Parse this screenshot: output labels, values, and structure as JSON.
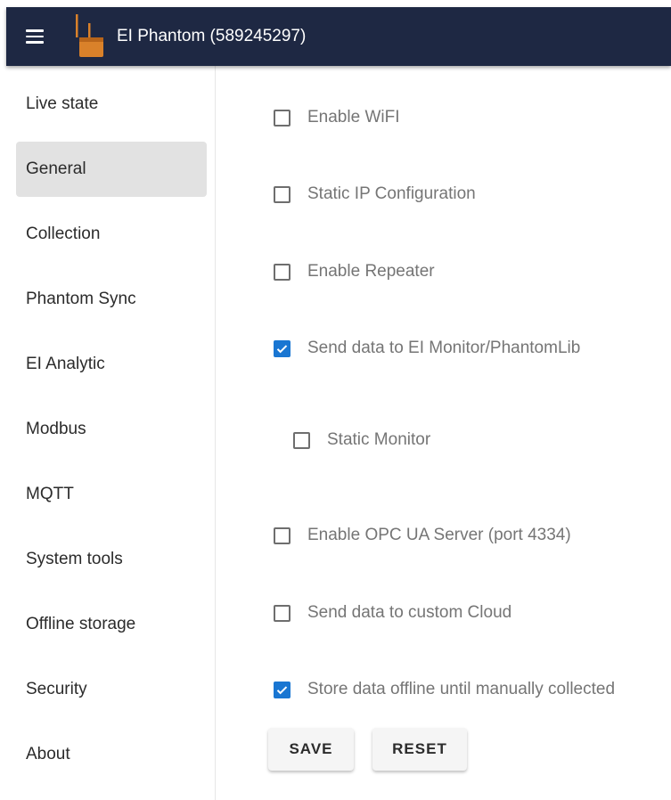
{
  "appbar": {
    "title": "EI Phantom (589245297)",
    "menu_icon": "hamburger-menu-icon",
    "logo_icon": "phantom-device-logo"
  },
  "sidebar": {
    "items": [
      {
        "label": "Live state",
        "active": false
      },
      {
        "label": "General",
        "active": true
      },
      {
        "label": "Collection",
        "active": false
      },
      {
        "label": "Phantom Sync",
        "active": false
      },
      {
        "label": "EI Analytic",
        "active": false
      },
      {
        "label": "Modbus",
        "active": false
      },
      {
        "label": "MQTT",
        "active": false
      },
      {
        "label": "System tools",
        "active": false
      },
      {
        "label": "Offline storage",
        "active": false
      },
      {
        "label": "Security",
        "active": false
      },
      {
        "label": "About",
        "active": false
      }
    ]
  },
  "settings": {
    "options": [
      {
        "label": "Enable WiFI",
        "checked": false
      },
      {
        "label": "Static IP Configuration",
        "checked": false
      },
      {
        "label": "Enable Repeater",
        "checked": false
      },
      {
        "label": "Send data to EI Monitor/PhantomLib",
        "checked": true
      },
      {
        "label": "Static Monitor",
        "checked": false
      },
      {
        "label": "Enable OPC UA Server (port 4334)",
        "checked": false
      },
      {
        "label": "Send data to custom Cloud",
        "checked": false
      },
      {
        "label": "Store data offline until manually collected",
        "checked": true
      }
    ],
    "save_label": "SAVE",
    "reset_label": "RESET"
  },
  "colors": {
    "appbar_bg": "#1e2843",
    "accent": "#1976d2",
    "active_nav_bg": "#e2e2e2"
  }
}
